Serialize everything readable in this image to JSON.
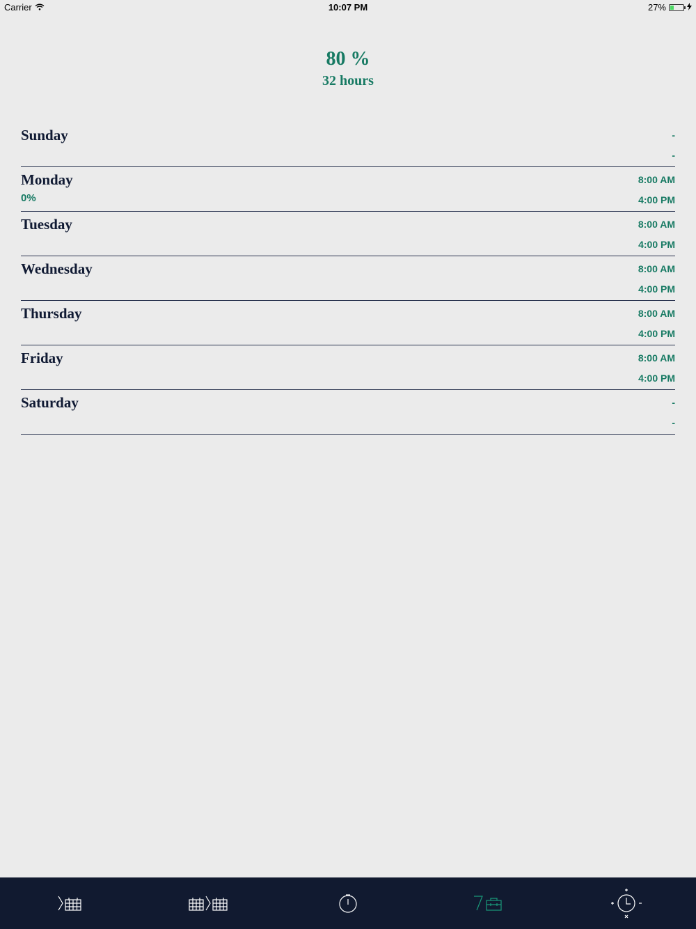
{
  "status_bar": {
    "carrier": "Carrier",
    "time": "10:07 PM",
    "battery_percent": "27%",
    "battery_level": 0.27
  },
  "summary": {
    "percent": "80 %",
    "hours": "32 hours"
  },
  "days": [
    {
      "name": "Sunday",
      "start": "-",
      "end": "-",
      "percent": ""
    },
    {
      "name": "Monday",
      "start": "8:00 AM",
      "end": "4:00 PM",
      "percent": "0%"
    },
    {
      "name": "Tuesday",
      "start": "8:00 AM",
      "end": "4:00 PM",
      "percent": ""
    },
    {
      "name": "Wednesday",
      "start": "8:00 AM",
      "end": "4:00 PM",
      "percent": ""
    },
    {
      "name": "Thursday",
      "start": "8:00 AM",
      "end": "4:00 PM",
      "percent": ""
    },
    {
      "name": "Friday",
      "start": "8:00 AM",
      "end": "4:00 PM",
      "percent": ""
    },
    {
      "name": "Saturday",
      "start": "-",
      "end": "-",
      "percent": ""
    }
  ],
  "tab_bar": {
    "tabs": [
      {
        "icon": "next-week-calendar-icon"
      },
      {
        "icon": "week-to-week-calendar-icon"
      },
      {
        "icon": "stopwatch-icon"
      },
      {
        "icon": "seven-day-work-icon",
        "active": true
      },
      {
        "icon": "clock-adjust-icon"
      }
    ],
    "active_color": "#1a9a7a",
    "inactive_color": "#ffffff"
  },
  "colors": {
    "background": "#ebebeb",
    "accent": "#177a63",
    "text": "#101a33",
    "tab_bar_bg": "#111a30"
  }
}
